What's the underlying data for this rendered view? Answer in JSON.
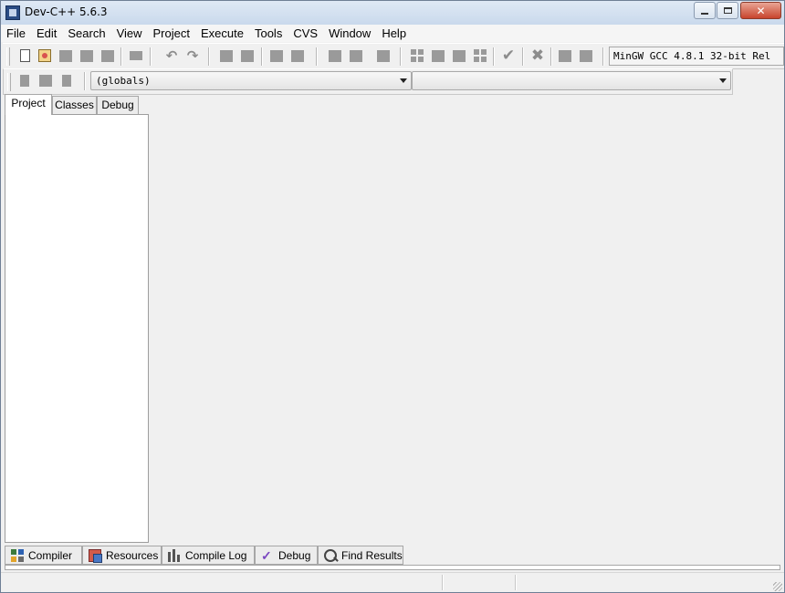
{
  "window": {
    "title": "Dev-C++ 5.6.3",
    "controls": [
      "minimize",
      "maximize",
      "close"
    ]
  },
  "menu": [
    "File",
    "Edit",
    "Search",
    "View",
    "Project",
    "Execute",
    "Tools",
    "CVS",
    "Window",
    "Help"
  ],
  "toolbar": {
    "compiler_label": "MinGW GCC 4.8.1 32-bit Rel"
  },
  "class_bar": {
    "scope_combo_value": "(globals)",
    "member_combo_value": ""
  },
  "left_panel": {
    "tabs": [
      "Project",
      "Classes",
      "Debug"
    ],
    "active_tab": "Project"
  },
  "bottom_panel": {
    "tabs": [
      {
        "label": "Compiler",
        "icon": "compiler-icon"
      },
      {
        "label": "Resources",
        "icon": "resources-icon"
      },
      {
        "label": "Compile Log",
        "icon": "compile-log-icon"
      },
      {
        "label": "Debug",
        "icon": "debug-icon"
      },
      {
        "label": "Find Results",
        "icon": "find-results-icon"
      }
    ]
  },
  "colors": {
    "window_bg": "#f0f0f0",
    "title_bar": "#dfe9f5",
    "close_button": "#c8442c",
    "disabled_icon": "#9a9a9a"
  }
}
